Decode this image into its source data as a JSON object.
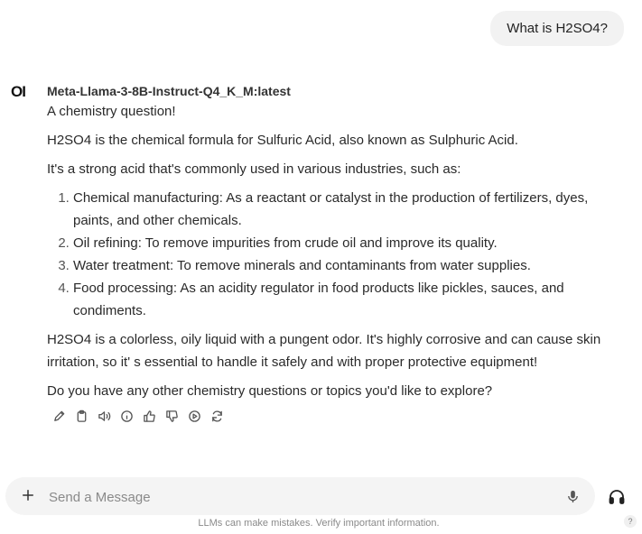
{
  "user_message": "What is H2SO4?",
  "assistant": {
    "avatar_text": "OI",
    "model_name": "Meta-Llama-3-8B-Instruct-Q4_K_M:latest",
    "intro": "A chemistry question!",
    "para1": "H2SO4 is the chemical formula for Sulfuric Acid, also known as Sulphuric Acid.",
    "para2": "It's a strong acid that's commonly used in various industries, such as:",
    "list": [
      "Chemical manufacturing: As a reactant or catalyst in the production of fertilizers, dyes, paints, and other chemicals.",
      "Oil refining: To remove impurities from crude oil and improve its quality.",
      "Water treatment: To remove minerals and contaminants from water supplies.",
      "Food processing: As an acidity regulator in food products like pickles, sauces, and condiments."
    ],
    "para3": "H2SO4 is a colorless, oily liquid with a pungent odor. It's highly corrosive and can cause skin irritation, so it' s essential to handle it safely and with proper protective equipment!",
    "para4": "Do you have any other chemistry questions or topics you'd like to explore?",
    "actions": [
      "edit-icon",
      "copy-icon",
      "read-aloud-icon",
      "info-icon",
      "thumbs-up-icon",
      "thumbs-down-icon",
      "continue-icon",
      "regenerate-icon"
    ]
  },
  "composer": {
    "placeholder": "Send a Message",
    "value": ""
  },
  "footer": {
    "disclaimer": "LLMs can make mistakes. Verify important information.",
    "help": "?"
  }
}
